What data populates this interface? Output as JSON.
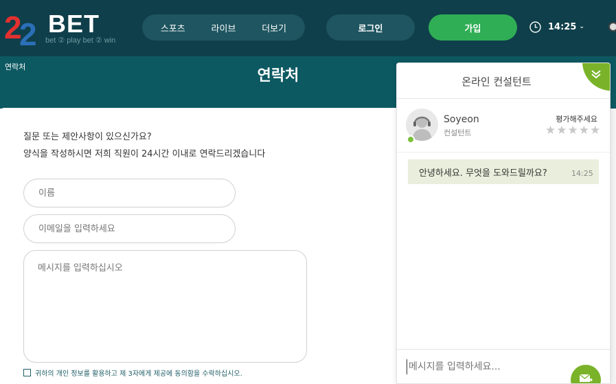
{
  "header": {
    "logo_text": "BET",
    "logo_sub": "bet ② play  bet ② win",
    "nav": [
      "스포츠",
      "라이브",
      "더보기"
    ],
    "login_label": "로그인",
    "signup_label": "가입",
    "time": "14:25",
    "brand_color": "#0f3f4a",
    "accent_color": "#2fae55"
  },
  "page": {
    "breadcrumb": "연락처",
    "title": "연락처"
  },
  "form": {
    "intro_line1": "질문 또는 제안사항이 있으신가요?",
    "intro_line2": "양식을 작성하시면 저희 직원이 24시간 이내로 연락드리겠습니다",
    "name_placeholder": "이름",
    "email_placeholder": "이메일을 입력하세요",
    "message_placeholder": "메시지를 입력하십시오",
    "consent_text": "귀하의 개인 정보를 활용하고 제 3자에게 제공에 동의함을 수락하십시오."
  },
  "chat": {
    "title": "온라인 컨설턴트",
    "agent_name": "Soyeon",
    "agent_role": "컨설턴트",
    "rate_label": "평가해주세요",
    "rating": 0,
    "max_rating": 5,
    "messages": [
      {
        "text": "안녕하세요. 무엇을 도와드릴까요?",
        "time": "14:25"
      }
    ],
    "input_placeholder": "메시지를 입력하세요...",
    "accent_color": "#7ab32a"
  }
}
